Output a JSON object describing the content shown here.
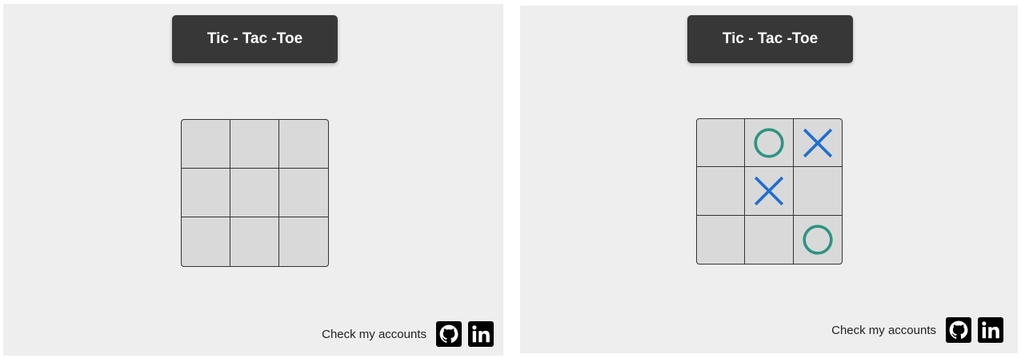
{
  "screens": [
    {
      "title": "Tic - Tac -Toe",
      "board": [
        "",
        "",
        "",
        "",
        "",
        "",
        "",
        "",
        ""
      ],
      "footer_text": "Check my accounts",
      "icons": [
        "github-icon",
        "linkedin-icon"
      ]
    },
    {
      "title": "Tic - Tac -Toe",
      "board": [
        "",
        "O",
        "X",
        "",
        "X",
        "",
        "",
        "",
        "O"
      ],
      "footer_text": "Check my accounts",
      "icons": [
        "github-icon",
        "linkedin-icon"
      ]
    }
  ],
  "colors": {
    "x_mark": "#1f6fd1",
    "o_mark": "#2e9482",
    "title_bg": "#373737",
    "panel_bg": "#eeeeee",
    "cell_bg": "#d9d9d9"
  }
}
